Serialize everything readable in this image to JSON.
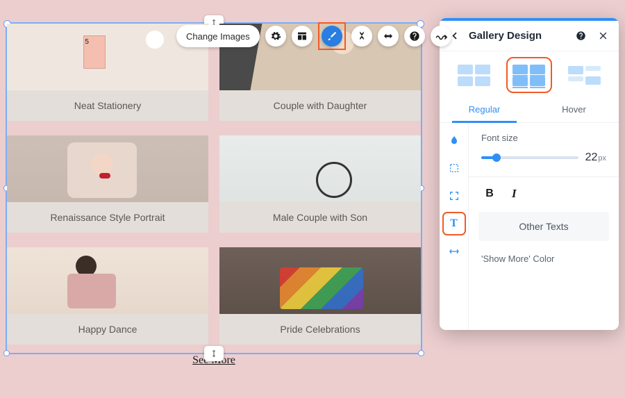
{
  "toolbar": {
    "change_images": "Change Images"
  },
  "gallery": {
    "items": [
      {
        "caption": "Neat Stationery"
      },
      {
        "caption": "Couple with Daughter"
      },
      {
        "caption": "Renaissance Style Portrait"
      },
      {
        "caption": "Male Couple with Son"
      },
      {
        "caption": "Happy Dance"
      },
      {
        "caption": "Pride Celebrations"
      }
    ],
    "see_more": "See More"
  },
  "panel": {
    "title": "Gallery Design",
    "tabs": {
      "regular": "Regular",
      "hover": "Hover"
    },
    "font_size_label": "Font size",
    "font_size_value": "22",
    "font_size_unit": "px",
    "other_texts": "Other Texts",
    "show_more_color_label": "'Show More' Color",
    "show_more_color": "#2a2a2a"
  }
}
